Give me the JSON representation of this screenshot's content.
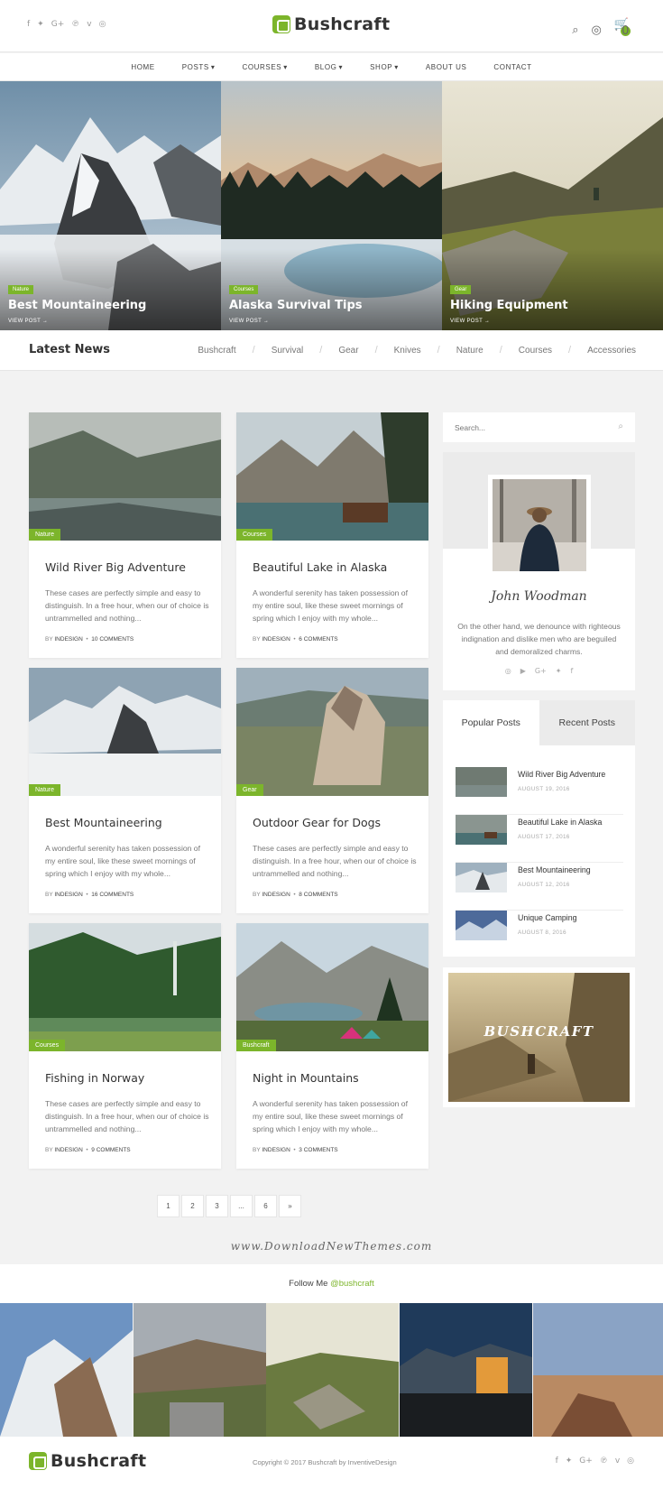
{
  "brand": {
    "name": "Bushcraft",
    "accent": "#7cb52b"
  },
  "header": {
    "social_icons": [
      "facebook-icon",
      "twitter-icon",
      "google-plus-icon",
      "pinterest-icon",
      "vimeo-icon",
      "instagram-icon"
    ],
    "social_glyphs": [
      "f",
      "🐦",
      "G+",
      "℗",
      "v",
      "◎"
    ],
    "cart_count": "0"
  },
  "nav": {
    "items": [
      {
        "label": "HOME",
        "dropdown": false
      },
      {
        "label": "POSTS",
        "dropdown": true
      },
      {
        "label": "COURSES",
        "dropdown": true
      },
      {
        "label": "BLOG",
        "dropdown": true
      },
      {
        "label": "SHOP",
        "dropdown": true
      },
      {
        "label": "ABOUT US",
        "dropdown": false
      },
      {
        "label": "CONTACT",
        "dropdown": false
      }
    ]
  },
  "hero": [
    {
      "tag": "Nature",
      "title": "Best Mountaineering",
      "link": "VIEW POST"
    },
    {
      "tag": "Courses",
      "title": "Alaska Survival Tips",
      "link": "VIEW POST"
    },
    {
      "tag": "Gear",
      "title": "Hiking Equipment",
      "link": "VIEW POST"
    }
  ],
  "category_bar": {
    "heading": "Latest News",
    "categories": [
      "Bushcraft",
      "Survival",
      "Gear",
      "Knives",
      "Nature",
      "Courses",
      "Accessories"
    ]
  },
  "cards": [
    {
      "tag": "Nature",
      "title": "Wild River Big Adventure",
      "excerpt": "These cases are perfectly simple and easy to distinguish. In a free hour, when our of choice is untrammelled and nothing...",
      "by": "BY",
      "author": "INDESIGN",
      "comments": "10 COMMENTS"
    },
    {
      "tag": "Courses",
      "title": "Beautiful Lake in Alaska",
      "excerpt": "A wonderful serenity has taken possession of my entire soul, like these sweet mornings of spring which I enjoy with my whole...",
      "by": "BY",
      "author": "INDESIGN",
      "comments": "6 COMMENTS"
    },
    {
      "tag": "Nature",
      "title": "Best Mountaineering",
      "excerpt": "A wonderful serenity has taken possession of my entire soul, like these sweet mornings of spring which I enjoy with my whole...",
      "by": "BY",
      "author": "INDESIGN",
      "comments": "16 COMMENTS"
    },
    {
      "tag": "Gear",
      "title": "Outdoor Gear for Dogs",
      "excerpt": "These cases are perfectly simple and easy to distinguish. In a free hour, when our of choice is untrammelled and nothing...",
      "by": "BY",
      "author": "INDESIGN",
      "comments": "8 COMMENTS"
    },
    {
      "tag": "Courses",
      "title": "Fishing in Norway",
      "excerpt": "These cases are perfectly simple and easy to distinguish. In a free hour, when our of choice is untrammelled and nothing...",
      "by": "BY",
      "author": "INDESIGN",
      "comments": "9 COMMENTS"
    },
    {
      "tag": "Bushcraft",
      "title": "Night in Mountains",
      "excerpt": "A wonderful serenity has taken possession of my entire soul, like these sweet mornings of spring which I enjoy with my whole...",
      "by": "BY",
      "author": "INDESIGN",
      "comments": "3 COMMENTS"
    }
  ],
  "sidebar": {
    "search_placeholder": "Search...",
    "author": {
      "signature": "John Woodman",
      "bio": "On the other hand, we denounce with righteous indignation and dislike men who are beguiled and demoralized charms."
    },
    "tabs": [
      "Popular Posts",
      "Recent Posts"
    ],
    "popular": [
      {
        "title": "Wild River Big Adventure",
        "date": "AUGUST 19, 2016"
      },
      {
        "title": "Beautiful Lake in Alaska",
        "date": "AUGUST 17, 2016"
      },
      {
        "title": "Best Mountaineering",
        "date": "AUGUST 12, 2016"
      },
      {
        "title": "Unique Camping",
        "date": "AUGUST 8, 2016"
      }
    ],
    "ad_text": "BUSHCRAFT"
  },
  "pagination": [
    "1",
    "2",
    "3",
    "...",
    "6",
    "»"
  ],
  "watermark": "www.DownloadNewThemes.com",
  "follow": {
    "prefix": "Follow Me",
    "handle": "@bushcraft"
  },
  "footer": {
    "copyright": "Copyright © 2017 Bushcraft by InventiveDesign"
  }
}
